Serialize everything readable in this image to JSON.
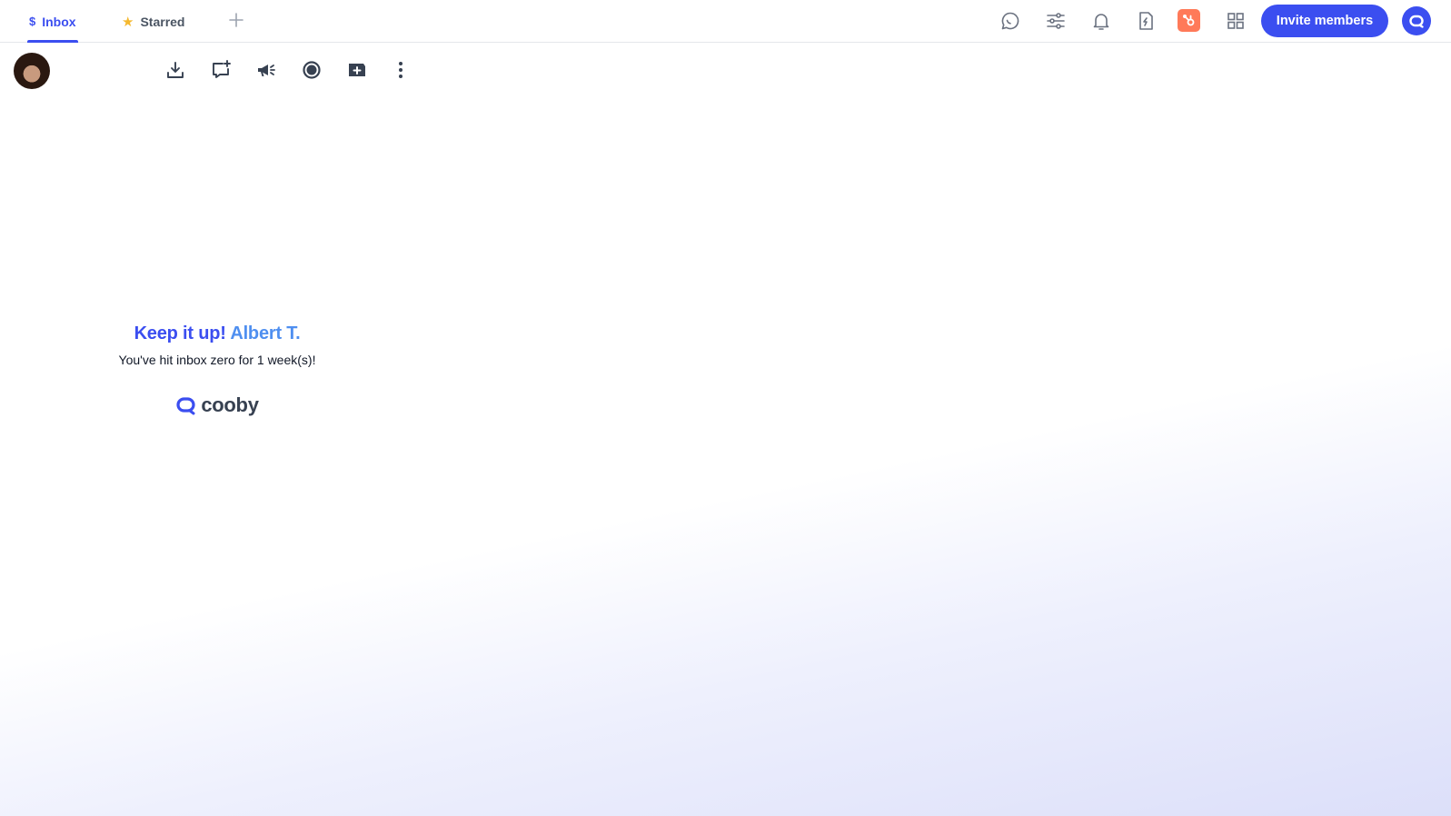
{
  "tabs": [
    {
      "label": "Inbox",
      "icon": "dollar-icon",
      "active": true
    },
    {
      "label": "Starred",
      "icon": "star-icon",
      "active": false
    }
  ],
  "header": {
    "invite_label": "Invite members",
    "icons": [
      "chat-bubble-icon",
      "sliders-icon",
      "bell-icon",
      "file-bolt-icon",
      "hubspot-icon",
      "grid-icon",
      "account-icon"
    ]
  },
  "toolbar": {
    "icons": [
      "download-icon",
      "add-comment-icon",
      "megaphone-icon",
      "record-icon",
      "add-box-icon",
      "more-vertical-icon"
    ]
  },
  "empty_state": {
    "headline": "Keep it up!",
    "name": "Albert T.",
    "message": "You've hit inbox zero for 1 week(s)!",
    "brand": "cooby"
  },
  "colors": {
    "accent": "#3b4ef0",
    "name_accent": "#4f8ff0",
    "hubspot": "#ff7a59"
  }
}
